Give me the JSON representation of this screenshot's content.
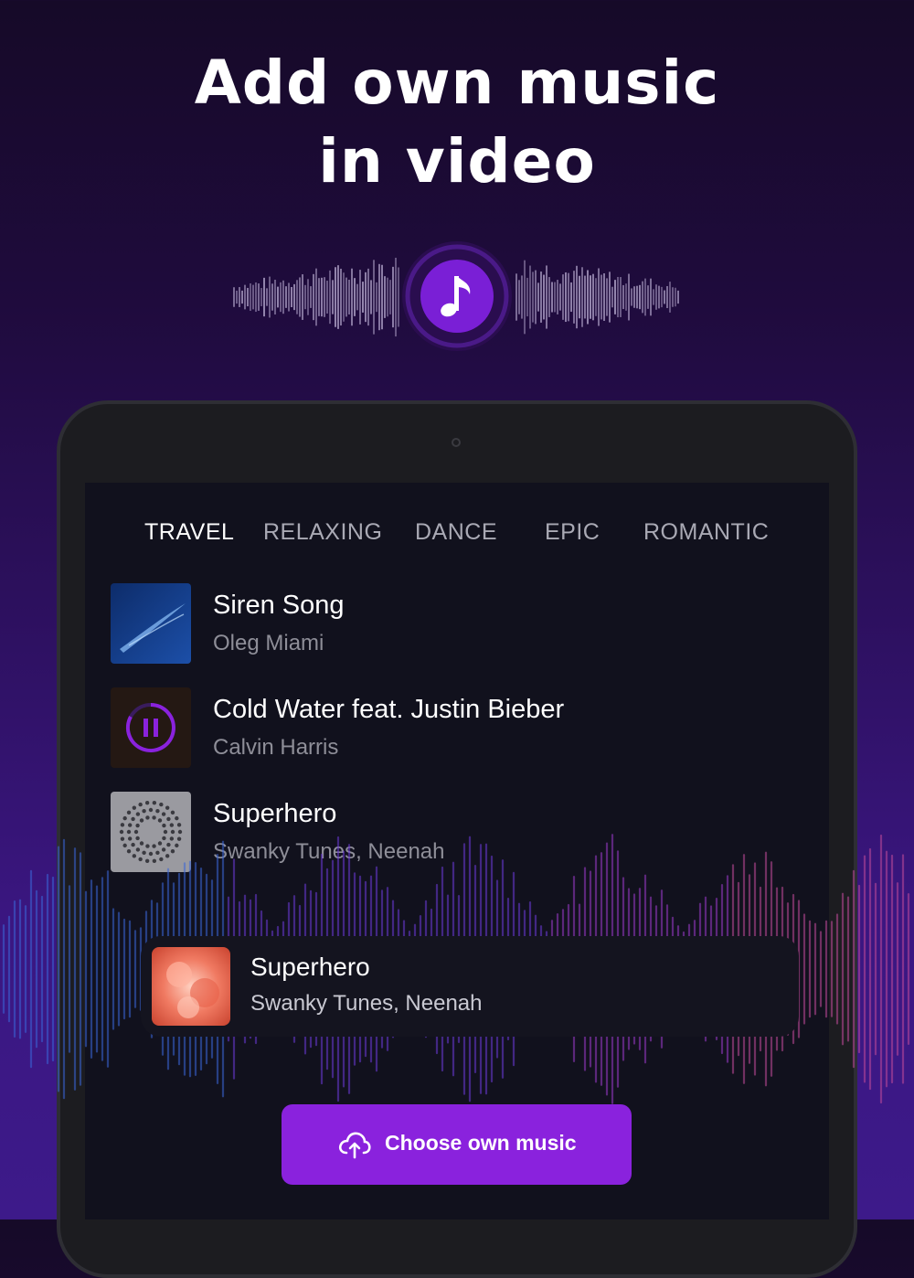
{
  "headline": {
    "line1": "Add own music",
    "line2": "in video"
  },
  "badge_icon": "music-note-icon",
  "tabs": [
    {
      "label": "TRAVEL",
      "active": true
    },
    {
      "label": "RELAXING",
      "active": false
    },
    {
      "label": "DANCE",
      "active": false
    },
    {
      "label": "EPIC",
      "active": false
    },
    {
      "label": "ROMANTIC",
      "active": false
    }
  ],
  "tracks": [
    {
      "title": "Siren Song",
      "artist": "Oleg Miami",
      "state": "idle"
    },
    {
      "title": "Cold Water feat. Justin Bieber",
      "artist": "Calvin Harris",
      "state": "playing"
    },
    {
      "title": "Superhero",
      "artist": "Swanky Tunes, Neenah",
      "state": "idle"
    }
  ],
  "now_playing": {
    "title": "Superhero",
    "artist": "Swanky Tunes, Neenah"
  },
  "choose_button": {
    "label": "Choose own music",
    "icon": "cloud-upload-icon"
  },
  "colors": {
    "accent": "#8a22dd",
    "badge": "#7a1fd6",
    "tab_active": "#ffffff",
    "tab_inactive": "#a9a9b4"
  }
}
